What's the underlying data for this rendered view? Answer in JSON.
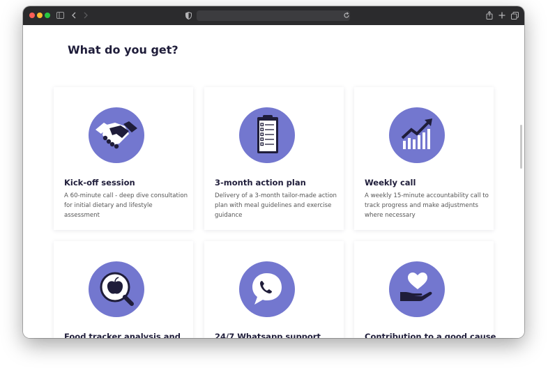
{
  "browser": {
    "icons": {
      "sidebar": "sidebar-icon",
      "back": "chevron-left-icon",
      "forward": "chevron-right-icon",
      "privacy": "shield-icon",
      "reload": "reload-icon",
      "share": "share-icon",
      "new_tab": "plus-icon",
      "tabs": "tabs-overview-icon"
    }
  },
  "page": {
    "heading": "What do you get?",
    "accent_color": "#7377cf",
    "cards": [
      {
        "title": "Kick-off session",
        "description": "A 60-minute call - deep dive consultation for initial dietary and lifestyle assessment",
        "icon": "handshake-icon"
      },
      {
        "title": "3-month action plan",
        "description": "Delivery of a 3-month tailor-made action plan with meal guidelines and exercise guidance",
        "icon": "clipboard-icon"
      },
      {
        "title": "Weekly call",
        "description": "A weekly 15-minute accountability call to track progress and make adjustments where necessary",
        "icon": "growth-chart-icon"
      },
      {
        "title": "Food tracker analysis and",
        "description": "",
        "icon": "apple-magnifier-icon"
      },
      {
        "title": "24/7 Whatsapp support",
        "description": "",
        "icon": "whatsapp-icon"
      },
      {
        "title": "Contribution to a good cause",
        "description": "",
        "icon": "heart-hand-icon"
      }
    ]
  }
}
